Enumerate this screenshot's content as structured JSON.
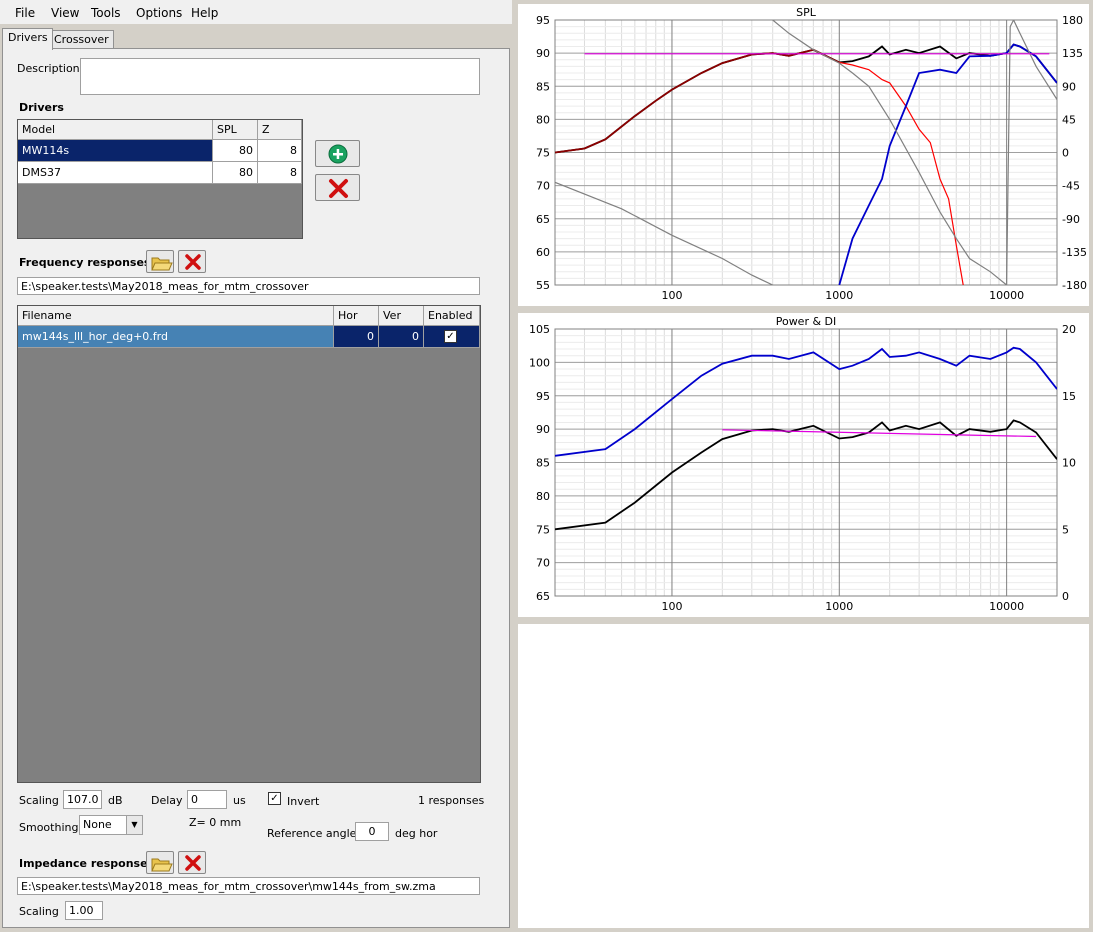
{
  "menu": [
    "File",
    "View",
    "Tools",
    "Options",
    "Help"
  ],
  "tabs": [
    "Drivers",
    "Crossover"
  ],
  "description_label": "Description",
  "description_value": "",
  "drivers": {
    "heading": "Drivers",
    "columns": [
      "Model",
      "SPL",
      "Z"
    ],
    "rows": [
      {
        "model": "MW114s",
        "spl": "80",
        "z": "8"
      },
      {
        "model": "DMS37",
        "spl": "80",
        "z": "8"
      }
    ]
  },
  "freq": {
    "heading": "Frequency responses",
    "path": "E:\\speaker.tests\\May2018_meas_for_mtm_crossover",
    "columns": [
      "Filename",
      "Hor",
      "Ver",
      "Enabled"
    ],
    "rows": [
      {
        "filename": "mw144s_lll_hor_deg+0.frd",
        "hor": "0",
        "ver": "0",
        "enabled": "✓"
      }
    ]
  },
  "controls": {
    "scaling_label": "Scaling",
    "scaling_value": "107.0",
    "scaling_unit": "dB",
    "delay_label": "Delay",
    "delay_value": "0",
    "delay_unit": "us",
    "invert_label": "Invert",
    "invert_checked": "✓",
    "responses_count": "1 responses",
    "smoothing_label": "Smoothing",
    "smoothing_value": "None",
    "z_label": "Z= 0 mm",
    "refangle_label": "Reference angle",
    "refangle_value": "0",
    "refangle_unit": "deg hor"
  },
  "impedance": {
    "heading": "Impedance response",
    "path": "E:\\speaker.tests\\May2018_meas_for_mtm_crossover\\mw144s_from_sw.zma",
    "scaling_label": "Scaling",
    "scaling_value": "1.00"
  },
  "colors": {
    "selection": "#0a246a",
    "accent": "#4682b4",
    "target": "#e000e0"
  },
  "chart_data": [
    {
      "type": "line",
      "title": "SPL",
      "x_scale": "log",
      "xlim": [
        20,
        20000
      ],
      "ylim": [
        55,
        95
      ],
      "y2lim": [
        -180,
        180
      ],
      "x_ticks": [
        100,
        1000,
        10000
      ],
      "y_ticks": [
        55,
        60,
        65,
        70,
        75,
        80,
        85,
        90,
        95
      ],
      "y2_ticks": [
        -180,
        -135,
        -90,
        -45,
        0,
        45,
        90,
        135,
        180
      ],
      "grid": true,
      "series": [
        {
          "color": "#000000",
          "x": [
            20,
            30,
            40,
            60,
            80,
            100,
            150,
            200,
            300,
            400,
            500,
            700,
            1000,
            1200,
            1500,
            1800,
            2000,
            2500,
            3000,
            4000,
            5000,
            6000,
            8000,
            10000,
            11000,
            12000,
            15000,
            20000
          ],
          "y": [
            75,
            75.6,
            77,
            80.5,
            82.8,
            84.5,
            87,
            88.5,
            89.8,
            90,
            89.6,
            90.5,
            88.6,
            88.8,
            89.5,
            91,
            89.8,
            90.5,
            90,
            91,
            89.2,
            90,
            89.6,
            90,
            91.3,
            91,
            89.5,
            85.5
          ]
        },
        {
          "color": "#8b0000",
          "x": [
            20,
            30,
            40,
            60,
            80,
            100,
            150,
            200,
            300,
            400,
            500,
            700,
            1000
          ],
          "y": [
            75,
            75.6,
            77,
            80.5,
            82.8,
            84.5,
            87,
            88.5,
            89.8,
            90,
            89.6,
            90.5,
            88.6
          ]
        },
        {
          "color": "#ff0000",
          "x": [
            1000,
            1200,
            1500,
            1800,
            2000,
            2500,
            3000,
            3500,
            4000,
            4500,
            5000,
            5500
          ],
          "y": [
            88.6,
            88.2,
            87.5,
            86,
            85.5,
            82,
            78.5,
            76.5,
            71,
            68,
            61,
            55
          ]
        },
        {
          "color": "#0000cc",
          "x": [
            1000,
            1200,
            1500,
            1800,
            2000,
            2500,
            3000,
            4000,
            5000,
            6000,
            8000,
            10000,
            11000,
            12000,
            15000,
            20000
          ],
          "y": [
            55,
            62,
            67,
            71,
            76,
            82,
            87,
            87.5,
            87,
            89.5,
            89.6,
            90,
            91.3,
            91,
            89.5,
            85.5
          ]
        },
        {
          "color": "#808080",
          "x": [
            20,
            50,
            100,
            200,
            300,
            400
          ],
          "y": [
            70.5,
            66.5,
            62.5,
            59,
            56.5,
            55
          ]
        },
        {
          "color": "#808080",
          "x": [
            400,
            500,
            700,
            1000,
            1200,
            1500,
            2000,
            3000,
            4000,
            5000,
            6000,
            8000,
            10000
          ],
          "y": [
            95,
            93,
            90.5,
            88.5,
            87,
            85,
            80,
            72,
            66,
            62,
            59,
            57,
            55
          ]
        },
        {
          "color": "#808080",
          "x": [
            10000,
            10500,
            11000,
            12000,
            15000,
            20000
          ],
          "y": [
            55,
            94,
            95,
            93,
            88,
            83
          ]
        },
        {
          "color": "#e000e0",
          "x": [
            30,
            18000
          ],
          "y": [
            89.9,
            89.9
          ]
        }
      ]
    },
    {
      "type": "line",
      "title": "Power & DI",
      "x_scale": "log",
      "xlim": [
        20,
        20000
      ],
      "ylim": [
        65,
        105
      ],
      "y2lim": [
        0,
        20
      ],
      "x_ticks": [
        100,
        1000,
        10000
      ],
      "y_ticks": [
        65,
        70,
        75,
        80,
        85,
        90,
        95,
        100,
        105
      ],
      "y2_ticks": [
        0,
        5,
        10,
        15,
        20
      ],
      "grid": true,
      "series": [
        {
          "color": "#0000cc",
          "x": [
            20,
            40,
            60,
            100,
            150,
            200,
            300,
            400,
            500,
            700,
            1000,
            1200,
            1500,
            1800,
            2000,
            2500,
            3000,
            4000,
            5000,
            6000,
            8000,
            10000,
            11000,
            12000,
            15000,
            20000
          ],
          "y": [
            86,
            87,
            90,
            94.5,
            98,
            99.8,
            101,
            101,
            100.5,
            101.5,
            99,
            99.5,
            100.5,
            102,
            100.8,
            101,
            101.5,
            100.5,
            99.5,
            101,
            100.5,
            101.5,
            102.2,
            102,
            100,
            96
          ]
        },
        {
          "color": "#000000",
          "x": [
            20,
            40,
            60,
            100,
            150,
            200,
            300,
            400,
            500,
            700,
            1000,
            1200,
            1500,
            1800,
            2000,
            2500,
            3000,
            4000,
            5000,
            6000,
            8000,
            10000,
            11000,
            12000,
            15000,
            20000
          ],
          "y": [
            75,
            76,
            79,
            83.5,
            86.5,
            88.5,
            89.8,
            90,
            89.6,
            90.5,
            88.6,
            88.8,
            89.5,
            91,
            89.8,
            90.5,
            90,
            91,
            89,
            90,
            89.6,
            90,
            91.3,
            91,
            89.5,
            85.5
          ]
        },
        {
          "color": "#e000e0",
          "x": [
            200,
            15000
          ],
          "y": [
            89.9,
            88.9
          ]
        }
      ]
    }
  ]
}
